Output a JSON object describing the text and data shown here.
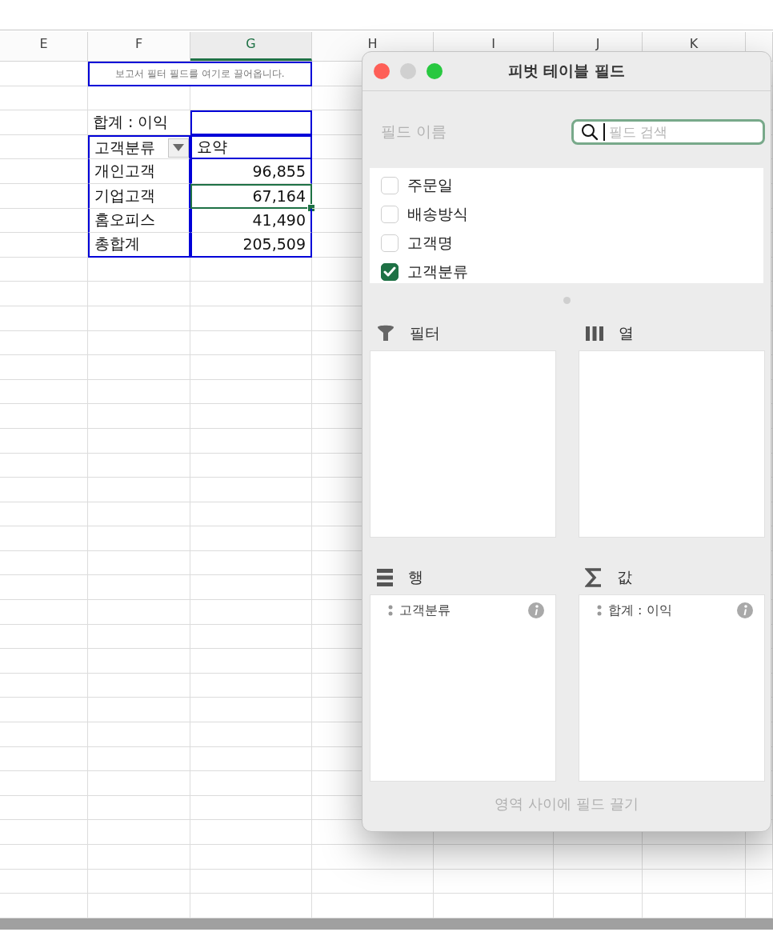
{
  "columns": [
    {
      "label": "E",
      "selected": false
    },
    {
      "label": "F",
      "selected": false
    },
    {
      "label": "G",
      "selected": true
    },
    {
      "label": "H",
      "selected": false
    },
    {
      "label": "I",
      "selected": false
    },
    {
      "label": "J",
      "selected": false
    },
    {
      "label": "K",
      "selected": false
    }
  ],
  "report_filter_hint": "보고서 필터 필드를 여기로 끌어옵니다.",
  "pivot": {
    "data_field_label": "합계 : 이익",
    "row_header": "고객분류",
    "value_header": "요약",
    "rows": [
      {
        "label": "개인고객",
        "value": "96,855",
        "selected": false
      },
      {
        "label": "기업고객",
        "value": "67,164",
        "selected": true
      },
      {
        "label": "홈오피스",
        "value": "41,490",
        "selected": false
      }
    ],
    "grand_total": {
      "label": "총합계",
      "value": "205,509"
    }
  },
  "panel": {
    "title": "피벗 테이블 필드",
    "field_name_label": "필드 이름",
    "search": {
      "placeholder": "필드 검색"
    },
    "fields": [
      {
        "label": "주문일",
        "checked": false
      },
      {
        "label": "배송방식",
        "checked": false
      },
      {
        "label": "고객명",
        "checked": false
      },
      {
        "label": "고객분류",
        "checked": true
      }
    ],
    "areas": [
      {
        "kind": "filter",
        "label": "필터"
      },
      {
        "kind": "columns",
        "label": "열"
      },
      {
        "kind": "rows",
        "label": "행",
        "items": [
          "고객분류"
        ]
      },
      {
        "kind": "values",
        "label": "값",
        "items": [
          "합계 : 이익"
        ]
      }
    ],
    "footer_hint": "영역 사이에 필드 끌기"
  }
}
